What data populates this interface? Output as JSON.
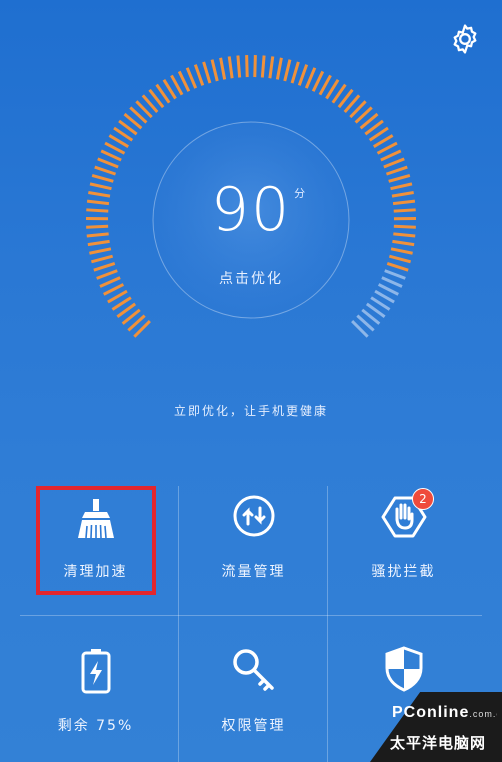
{
  "score": {
    "value": "90",
    "unit": "分",
    "action": "点击优化",
    "progress": 0.9
  },
  "tip": "立即优化，让手机更健康",
  "tiles": [
    {
      "label": "清理加速",
      "icon": "broom-icon"
    },
    {
      "label": "流量管理",
      "icon": "data-transfer-icon"
    },
    {
      "label": "骚扰拦截",
      "icon": "block-hand-icon",
      "badge": "2"
    },
    {
      "label": "剩余 75%",
      "icon": "battery-icon"
    },
    {
      "label": "权限管理",
      "icon": "key-icon"
    },
    {
      "label": "",
      "icon": "shield-icon"
    }
  ],
  "watermark": {
    "brand": "PConline",
    "domain": ".com.cn",
    "cn": "太平洋电脑网"
  },
  "colors": {
    "gauge_active": "#f0913a",
    "gauge_inactive": "#cfe0f7",
    "highlight": "#e3262e",
    "badge": "#ef4b3c"
  }
}
